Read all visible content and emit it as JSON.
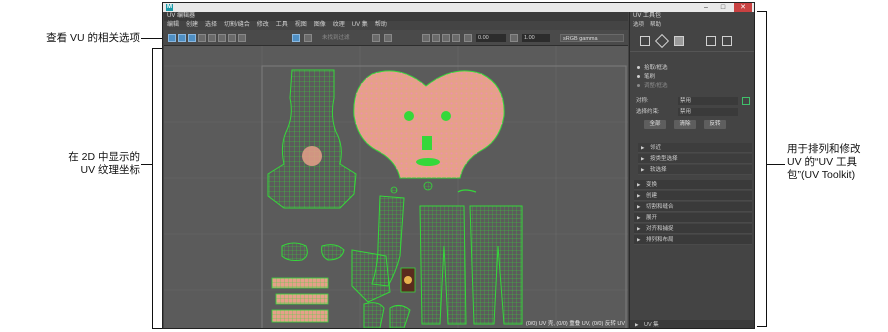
{
  "callouts": {
    "left_top": "查看 VU 的相关选项",
    "left_mid_line1": "在 2D 中显示的",
    "left_mid_line2": "UV 纹理坐标",
    "right_line1": "用于排列和修改",
    "right_line2": "UV 的“UV 工具",
    "right_line3": "包”(UV Toolkit)"
  },
  "window": {
    "logo": "M",
    "controls": [
      "–",
      "□",
      "✕"
    ]
  },
  "editor": {
    "title": "UV 编辑器",
    "menu": [
      "编辑",
      "创建",
      "选择",
      "切割/缝合",
      "修改",
      "工具",
      "视图",
      "图像",
      "纹理",
      "UV 集",
      "帮助"
    ],
    "toolbar": {
      "filter_placeholder": "未找到过滤",
      "value_1": "0.00",
      "value_2": "1.00",
      "color_space": "sRGB gamma"
    },
    "status": "(0/0) UV 壳, (0/0) 重叠 UV, (0/0) 反转 UV"
  },
  "toolkit": {
    "title": "UV 工具包",
    "menu": [
      "选项",
      "帮助"
    ],
    "radios": [
      "拾取/框选",
      "笔刷",
      "调整/框选"
    ],
    "symmetry_label": "对称:",
    "symmetry_value": "禁用",
    "select_label": "选择约束:",
    "select_value": "禁用",
    "buttons": [
      "全部",
      "清除",
      "反转"
    ],
    "subsections": [
      "邻近",
      "按类型选择",
      "软选择"
    ],
    "sections": [
      "变换",
      "创建",
      "切割和缝合",
      "展开",
      "对齐和捕捉",
      "排列和布局"
    ],
    "footer": "UV 集"
  },
  "colors": {
    "uv_wire": "#35d83a",
    "selected_face": "#e6a08a",
    "uv_dot": "#f18bb0",
    "axis_red": "#d23b2c"
  }
}
